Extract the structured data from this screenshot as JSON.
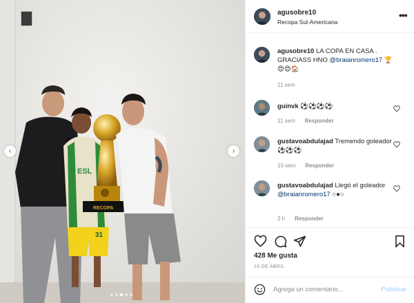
{
  "header": {
    "username": "agusobre10",
    "location": "Recopa Sul-Americana"
  },
  "caption": {
    "username": "agusobre10",
    "text": "LA COPA EN CASA . GRACIASS HNO ",
    "mention": "@braianromero17",
    "emojis": " 🏆😍😍🏠",
    "time": "11 sem"
  },
  "comments": [
    {
      "username": "guinvk",
      "text": "⚽⚽⚽⚽",
      "mention": "",
      "time": "11 sem",
      "reply": "Responder"
    },
    {
      "username": "gustavoabdulajad",
      "text": "Tremendo goleador ⚽⚽⚽",
      "mention": "",
      "time": "10 sem",
      "reply": "Responder"
    },
    {
      "username": "gustavoabdulajad",
      "text": "Llegó el goleador ",
      "mention": "@braianromero17",
      "extra": " ○●○",
      "time": "3 h",
      "reply": "Responder"
    }
  ],
  "likes": "428 Me gusta",
  "date": "16 DE ABRIL",
  "comment_input": {
    "placeholder": "Agrega un comentario..."
  },
  "publish_label": "Publicar",
  "more_label": "•••",
  "icons": {
    "like": "heart-icon",
    "comment": "comment-icon",
    "share": "paper-plane-icon",
    "save": "bookmark-icon",
    "emoji": "emoji-icon",
    "more": "more-icon"
  },
  "colors": {
    "mention": "#00376b",
    "secondary_text": "#8e8e8e",
    "publish_disabled": "#b3dbff"
  }
}
